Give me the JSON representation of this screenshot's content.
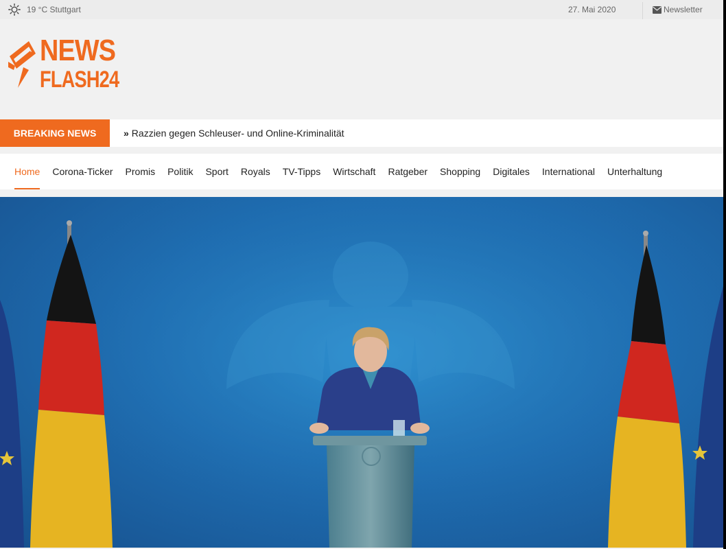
{
  "topbar": {
    "weather": "19 °C Stuttgart",
    "date": "27. Mai 2020",
    "newsletter": "Newsletter"
  },
  "logo": {
    "line1": "NEWS",
    "line2": "FLASH24"
  },
  "breaking": {
    "label": "BREAKING NEWS",
    "headline": "Razzien gegen Schleuser- und Online-Kriminalität"
  },
  "nav": {
    "items": [
      {
        "label": "Home"
      },
      {
        "label": "Corona-Ticker"
      },
      {
        "label": "Promis"
      },
      {
        "label": "Politik"
      },
      {
        "label": "Sport"
      },
      {
        "label": "Royals"
      },
      {
        "label": "TV-Tipps"
      },
      {
        "label": "Wirtschaft"
      },
      {
        "label": "Ratgeber"
      },
      {
        "label": "Shopping"
      },
      {
        "label": "Digitales"
      },
      {
        "label": "International"
      },
      {
        "label": "Unterhaltung"
      }
    ],
    "active_index": 0
  },
  "colors": {
    "accent": "#ef6a1f",
    "hero_blue": "#1f6fb3"
  }
}
